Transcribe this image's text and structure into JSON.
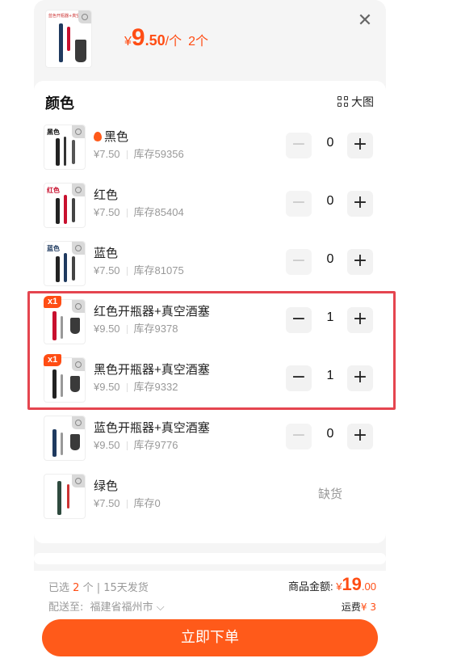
{
  "header": {
    "price_yen": "¥",
    "price_int": "9",
    "price_dec": ".50",
    "price_unit": "/个",
    "qty_text": "2个",
    "thumb_tag": "蓝色开瓶器+真空酒塞"
  },
  "panel": {
    "title": "颜色",
    "big_view_label": "大图"
  },
  "variants": [
    {
      "name": "黑色",
      "price": "¥7.50",
      "stock": "库存59356",
      "qty": "0",
      "hot": true,
      "tag": "黑色"
    },
    {
      "name": "红色",
      "price": "¥7.50",
      "stock": "库存85404",
      "qty": "0",
      "tag": "红色"
    },
    {
      "name": "蓝色",
      "price": "¥7.50",
      "stock": "库存81075",
      "qty": "0",
      "tag": "蓝色"
    },
    {
      "name": "红色开瓶器+真空酒塞",
      "price": "¥9.50",
      "stock": "库存9378",
      "qty": "1",
      "badge": "x1"
    },
    {
      "name": "黑色开瓶器+真空酒塞",
      "price": "¥9.50",
      "stock": "库存9332",
      "qty": "1",
      "badge": "x1"
    },
    {
      "name": "蓝色开瓶器+真空酒塞",
      "price": "¥9.50",
      "stock": "库存9776",
      "qty": "0"
    },
    {
      "name": "绿色",
      "price": "¥7.50",
      "stock": "库存0",
      "soldout_label": "缺货"
    }
  ],
  "footer": {
    "selected_prefix": "已选",
    "selected_count": "2",
    "selected_suffix": "个 | 15天发货",
    "ship_to_label": "配送至:",
    "address": "福建省福州市",
    "amount_label": "商品金额:",
    "amount_yen": "¥",
    "amount_int": "19",
    "amount_dec": ".00",
    "freight_label": "运费",
    "freight_value": "¥ 3",
    "order_button": "立即下单"
  },
  "colors": {
    "accent": "#ff4d14",
    "highlight_box": "#e5454f"
  }
}
